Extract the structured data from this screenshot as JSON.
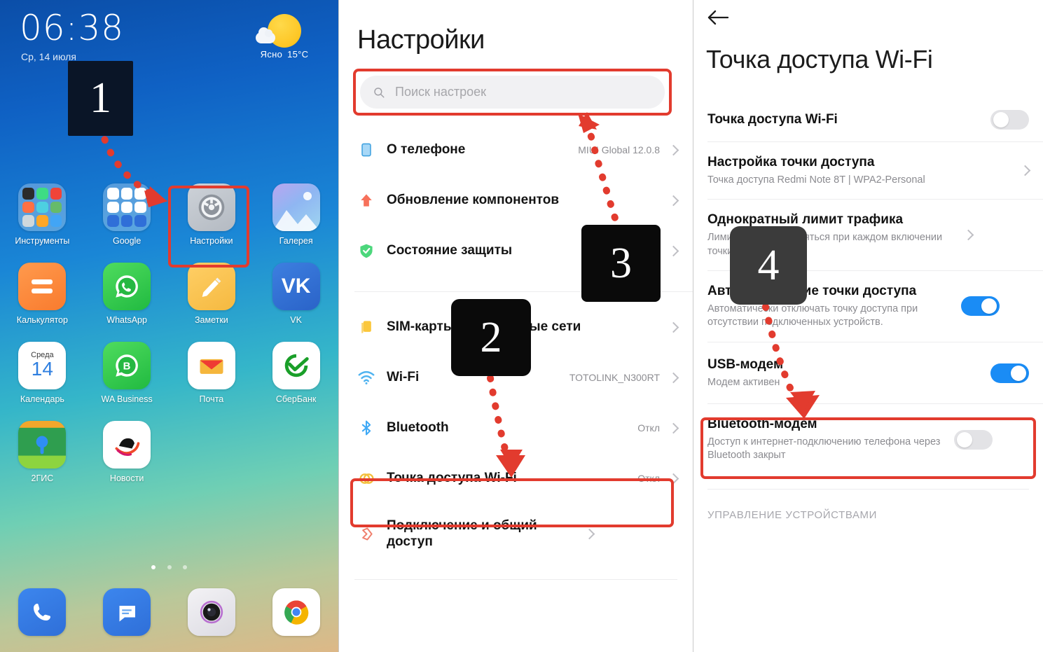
{
  "phone": {
    "clock": "06:38",
    "date": "Ср, 14 июля",
    "weather": {
      "condition": "Ясно",
      "temperature": "15°C",
      "icon": "partly-sunny-icon"
    },
    "apps": [
      {
        "label": "Инструменты",
        "icon": "folder-tools-icon"
      },
      {
        "label": "Google",
        "icon": "folder-google-icon"
      },
      {
        "label": "Настройки",
        "icon": "settings-gear-icon"
      },
      {
        "label": "Галерея",
        "icon": "gallery-icon"
      },
      {
        "label": "Калькулятор",
        "icon": "calculator-icon"
      },
      {
        "label": "WhatsApp",
        "icon": "whatsapp-icon"
      },
      {
        "label": "Заметки",
        "icon": "notes-icon"
      },
      {
        "label": "VK",
        "icon": "vk-icon"
      },
      {
        "label": "Календарь",
        "icon": "calendar-icon"
      },
      {
        "label": "WA Business",
        "icon": "whatsapp-business-icon"
      },
      {
        "label": "Почта",
        "icon": "mail-icon"
      },
      {
        "label": "СберБанк",
        "icon": "sberbank-icon"
      },
      {
        "label": "2ГИС",
        "icon": "2gis-icon"
      },
      {
        "label": "Новости",
        "icon": "news-icon"
      }
    ],
    "calendar_icon": {
      "weekday": "Среда",
      "day": "14"
    },
    "vk_icon_text": "VK",
    "dock": [
      {
        "label": "phone",
        "icon": "phone-icon"
      },
      {
        "label": "messages",
        "icon": "messages-icon"
      },
      {
        "label": "camera",
        "icon": "camera-icon"
      },
      {
        "label": "chrome",
        "icon": "chrome-icon"
      }
    ]
  },
  "settings": {
    "title": "Настройки",
    "search": {
      "placeholder": "Поиск настроек",
      "icon": "search-icon"
    },
    "items": [
      {
        "label": "О телефоне",
        "value": "MIUI Global 12.0.8",
        "icon": "phone-square-icon"
      },
      {
        "label": "Обновление компонентов",
        "value": "",
        "icon": "up-arrow-icon"
      },
      {
        "label": "Состояние защиты",
        "value": "",
        "icon": "shield-check-icon"
      },
      {
        "label": "SIM-карты и мобильные сети",
        "value": "",
        "icon": "sim-card-icon"
      },
      {
        "label": "Wi-Fi",
        "value": "TOTOLINK_N300RT",
        "icon": "wifi-icon"
      },
      {
        "label": "Bluetooth",
        "value": "Откл",
        "icon": "bluetooth-icon"
      },
      {
        "label": "Точка доступа Wi-Fi",
        "value": "Откл",
        "icon": "hotspot-icon"
      },
      {
        "label": "Подключение и общий доступ",
        "value": "",
        "icon": "sharing-icon"
      }
    ]
  },
  "hotspot": {
    "back_icon": "back-arrow-icon",
    "title": "Точка доступа Wi-Fi",
    "rows": [
      {
        "label": "Точка доступа Wi-Fi",
        "sub": "",
        "control": "toggle",
        "state": "off"
      },
      {
        "label": "Настройка точки доступа",
        "sub": "Точка доступа Redmi Note 8T | WPA2-Personal",
        "control": "chevron",
        "state": ""
      },
      {
        "label": "Однократный лимит трафика",
        "sub": "Лимит будет применяться при каждом включении точки доступа.",
        "control": "chevron",
        "state": ""
      },
      {
        "label": "Автоотключение точки доступа",
        "sub": "Автоматически отключать точку доступа при отсутствии подключенных устройств.",
        "control": "toggle",
        "state": "on"
      },
      {
        "label": "USB-модем",
        "sub": "Модем активен",
        "control": "toggle",
        "state": "on"
      },
      {
        "label": "Bluetooth-модем",
        "sub": "Доступ к интернет-подключению телефона через Bluetooth закрыт",
        "control": "toggle",
        "state": "off"
      }
    ],
    "section_label": "УПРАВЛЕНИЕ УСТРОЙСТВАМИ"
  },
  "annotations": {
    "badges": [
      {
        "number": "1",
        "color": "#0a1527"
      },
      {
        "number": "2",
        "color": "#0a0a0a"
      },
      {
        "number": "3",
        "color": "#0a0a0a"
      },
      {
        "number": "4",
        "color": "#3b3b3b"
      }
    ],
    "highlight_color": "#e23b2e",
    "arrow_color": "#e23b2e"
  }
}
